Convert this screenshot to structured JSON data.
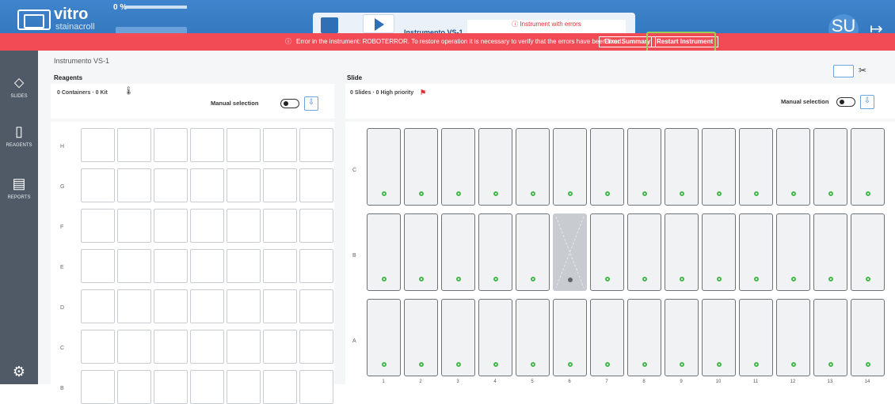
{
  "header": {
    "logo_text": "vitro",
    "logo_sub": "stainacroll",
    "progress_pct": "0 %",
    "instrument_title": "Instrumento VS-1",
    "error_status": "Instrument with errors",
    "user_initials": "SU"
  },
  "error_bar": {
    "message": "Error in the instrument: ROBOTERROR. To restore operation it is necessary to verify that the errors have been fixed.",
    "summary_button": "Error Summary",
    "restart_button": "Restart Instrument"
  },
  "sidebar": {
    "items": [
      {
        "label": "SLIDES",
        "icon": "slide-icon"
      },
      {
        "label": "REAGENTS",
        "icon": "reagent-icon"
      },
      {
        "label": "REPORTS",
        "icon": "report-icon"
      },
      {
        "label": "",
        "icon": "settings-icon"
      }
    ]
  },
  "main": {
    "breadcrumb": "Instrumento VS-1",
    "reagents": {
      "title": "Reagents",
      "summary": "0 Containers · 0 Kit",
      "manual_label": "Manual selection",
      "rows": [
        "H",
        "G",
        "F",
        "E",
        "D",
        "C",
        "B"
      ]
    },
    "slide": {
      "title": "Slide",
      "summary": "0 Slides · 0 High priority",
      "manual_label": "Manual selection",
      "rows": [
        "C",
        "B",
        "A"
      ],
      "columns": [
        "1",
        "2",
        "3",
        "4",
        "5",
        "6",
        "7",
        "8",
        "9",
        "10",
        "11",
        "12",
        "13",
        "14"
      ],
      "disabled_slot": {
        "row": "B",
        "column": "6"
      }
    }
  },
  "colors": {
    "header_blue": "#3a7ec5",
    "error_red": "#f24b55",
    "sidebar_gray": "#4f5a66",
    "highlight_green": "#9ccf5a",
    "slot_dot_green": "#42b64a"
  }
}
